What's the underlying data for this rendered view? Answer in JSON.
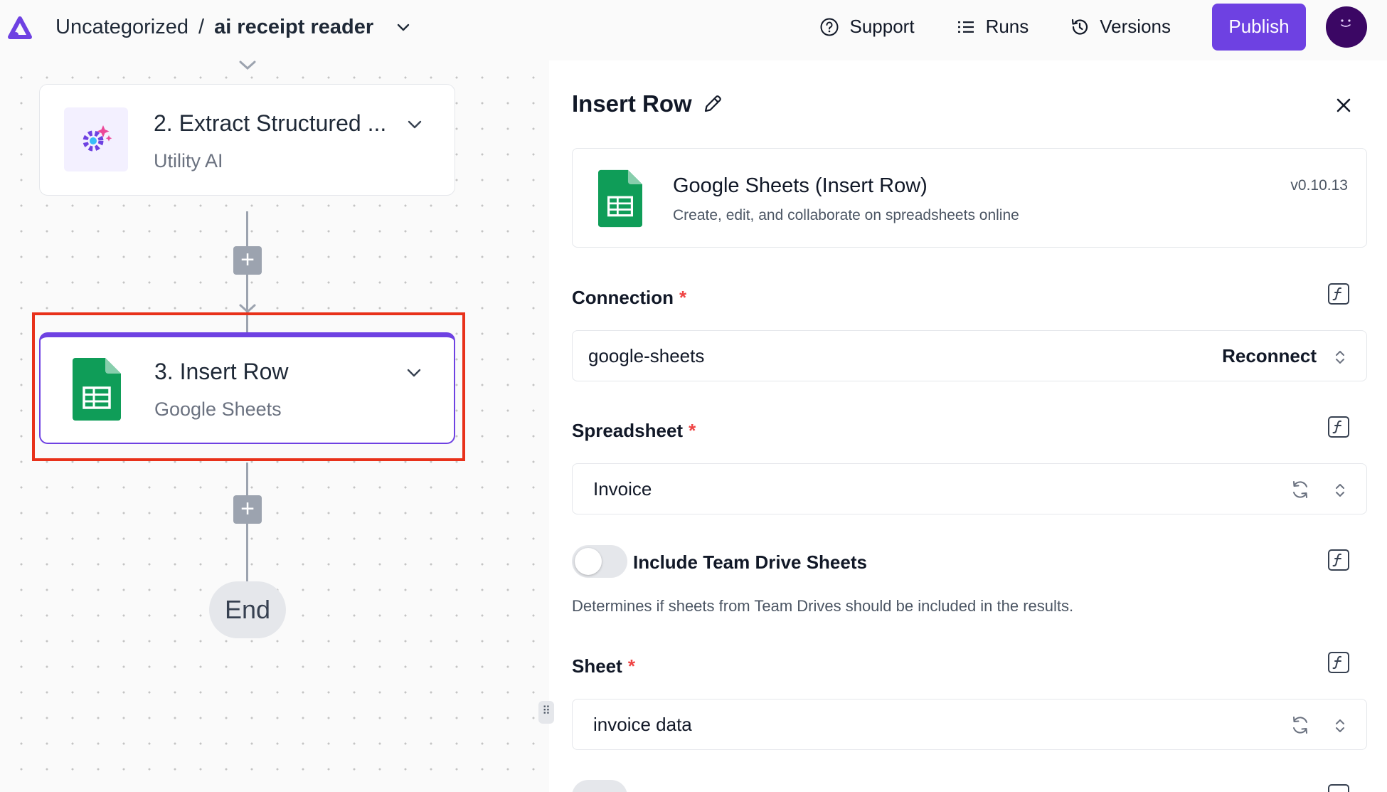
{
  "header": {
    "folder": "Uncategorized",
    "separator": "/",
    "flow_name": "ai receipt reader",
    "support_label": "Support",
    "runs_label": "Runs",
    "versions_label": "Versions",
    "publish_label": "Publish"
  },
  "canvas": {
    "steps": [
      {
        "title": "2. Extract Structured ...",
        "subtitle": "Utility AI"
      },
      {
        "title": "3. Insert Row",
        "subtitle": "Google Sheets"
      }
    ],
    "plus_label": "+",
    "end_label": "End"
  },
  "panel": {
    "title": "Insert Row",
    "piece": {
      "name": "Google Sheets (Insert Row)",
      "description": "Create, edit, and collaborate on spreadsheets online",
      "version": "v0.10.13"
    },
    "connection": {
      "label": "Connection",
      "required": "*",
      "value": "google-sheets",
      "reconnect_label": "Reconnect"
    },
    "spreadsheet": {
      "label": "Spreadsheet",
      "required": "*",
      "value": "Invoice"
    },
    "team_drive": {
      "label": "Include Team Drive Sheets",
      "help": "Determines if sheets from Team Drives should be included in the results.",
      "enabled": false
    },
    "sheet": {
      "label": "Sheet",
      "required": "*",
      "value": "invoice data"
    }
  },
  "colors": {
    "accent": "#6e41e2",
    "highlight": "#e8311a",
    "sheets_green": "#0f9d58",
    "required": "#ef4444"
  }
}
